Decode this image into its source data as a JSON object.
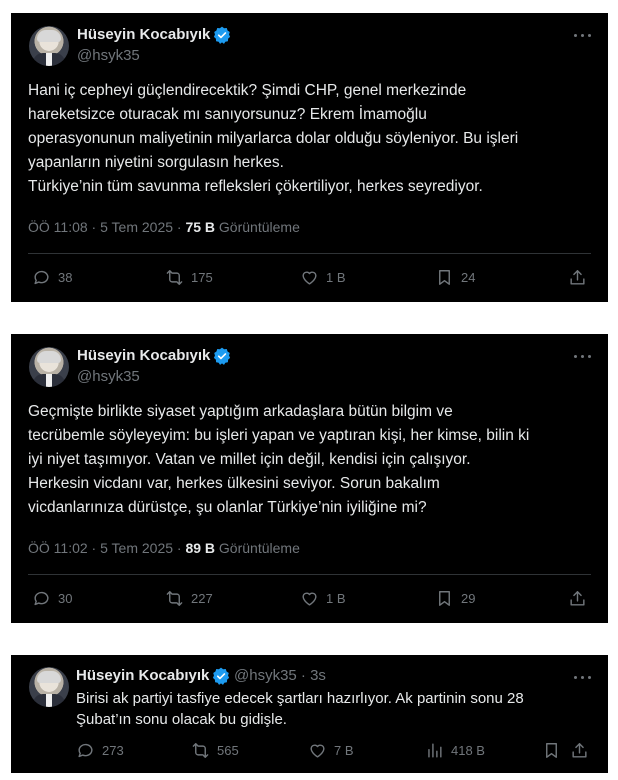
{
  "tweets": [
    {
      "author_name": "Hüseyin Kocabıyık",
      "handle": "@hsyk35",
      "text": "Hani iç cepheyi güçlendirecektik? Şimdi CHP, genel merkezinde\nhareketsizce oturacak mı sanıyorsunuz? Ekrem İmamoğlu\noperasyonunun maliyetinin milyarlarca dolar olduğu söyleniyor. Bu işleri\nyapanların niyetini sorgulasın herkes.\nTürkiye’nin tüm savunma refleksleri çökertiliyor, herkes seyrediyor.",
      "time": "ÖÖ 11:08 · 5 Tem 2025 · ",
      "views": "75 B",
      "views_label": " Görüntüleme",
      "replies": "38",
      "reposts": "175",
      "likes": "1 B",
      "bookmarks": "24"
    },
    {
      "author_name": "Hüseyin Kocabıyık",
      "handle": "@hsyk35",
      "text": "Geçmişte birlikte siyaset yaptığım arkadaşlara bütün bilgim ve\ntecrübemle söyleyeyim: bu işleri yapan ve yaptıran kişi, her kimse, bilin ki\niyi niyet taşımıyor. Vatan ve millet için değil, kendisi için çalışıyor.\nHerkesin vicdanı var, herkes ülkesini seviyor. Sorun bakalım\nvicdanlarınıza dürüstçe, şu olanlar Türkiye’nin iyiliğine mi?",
      "time": "ÖÖ 11:02 · 5 Tem 2025 · ",
      "views": "89 B",
      "views_label": " Görüntüleme",
      "replies": "30",
      "reposts": "227",
      "likes": "1 B",
      "bookmarks": "29"
    },
    {
      "author_name": "Hüseyin Kocabıyık",
      "handle": "@hsyk35 · 3s",
      "text": "Birisi ak partiyi tasfiye edecek şartları hazırlıyor. Ak partinin sonu 28\nŞubat’ın sonu olacak bu gidişle.",
      "replies": "273",
      "reposts": "565",
      "likes": "7 B",
      "views": "418 B"
    }
  ],
  "colors": {
    "card_bg": "#000000",
    "text": "#e7e9ea",
    "muted": "#71767b",
    "verified": "#1d9bf0",
    "divider": "#2f3336"
  }
}
